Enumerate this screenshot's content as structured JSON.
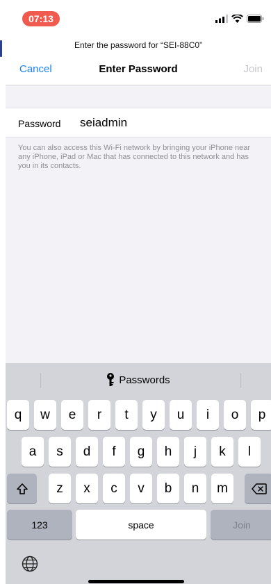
{
  "status_bar": {
    "time": "07:13"
  },
  "header": {
    "prompt": "Enter the password for “SEI-88C0”",
    "cancel_label": "Cancel",
    "title": "Enter Password",
    "join_label": "Join"
  },
  "password_field": {
    "label": "Password",
    "value": "seiadmin"
  },
  "helper_text": "You can also access this Wi-Fi network by bringing your iPhone near any iPhone, iPad or Mac that has connected to this network and has you in its contacts.",
  "keyboard": {
    "suggestion": "Passwords",
    "row1": [
      "q",
      "w",
      "e",
      "r",
      "t",
      "y",
      "u",
      "i",
      "o",
      "p"
    ],
    "row2": [
      "a",
      "s",
      "d",
      "f",
      "g",
      "h",
      "j",
      "k",
      "l"
    ],
    "row3": [
      "z",
      "x",
      "c",
      "v",
      "b",
      "n",
      "m"
    ],
    "numbers_label": "123",
    "space_label": "space",
    "join_label": "Join",
    "icons": {
      "shift": "shift-icon",
      "delete": "backspace-icon",
      "globe": "globe-icon",
      "key": "key-icon"
    }
  },
  "colors": {
    "accent": "#1a82f0",
    "time_pill": "#f05a4f",
    "keyboard_bg": "#d2d4da"
  }
}
